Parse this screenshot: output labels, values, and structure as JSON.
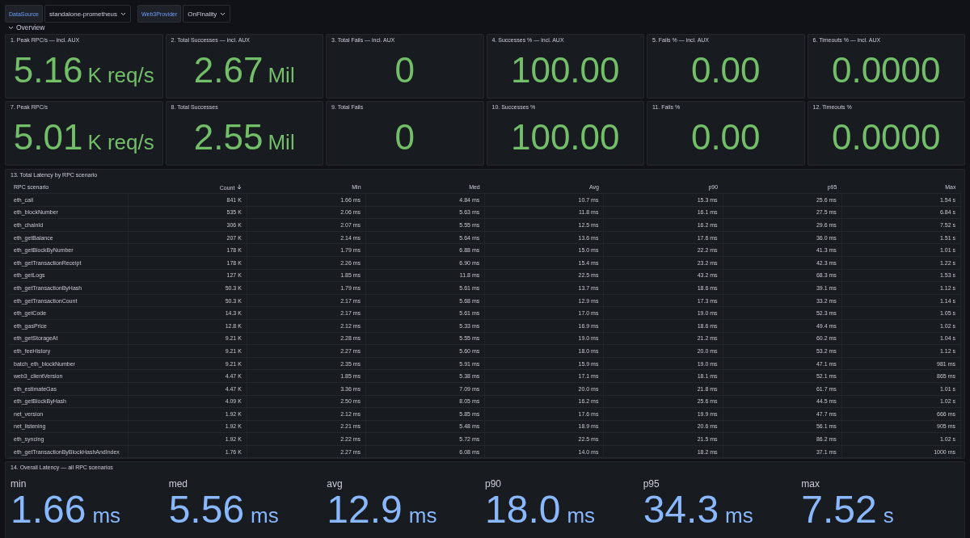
{
  "variables": [
    {
      "label": "DataSource",
      "value": "standalone-prometheus"
    },
    {
      "label": "Web3Provider",
      "value": "OnFinality"
    }
  ],
  "row": {
    "title": "Overview",
    "expanded": true
  },
  "stat_panels": [
    {
      "title": "1. Peak RPC/s — incl. AUX",
      "value": "5.16",
      "unit": "K req/s"
    },
    {
      "title": "2. Total Successes — incl. AUX",
      "value": "2.67",
      "unit": "Mil"
    },
    {
      "title": "3. Total Fails — incl. AUX",
      "value": "0"
    },
    {
      "title": "4. Successes % — incl. AUX",
      "value": "100.00"
    },
    {
      "title": "5. Fails % — incl. AUX",
      "value": "0.00"
    },
    {
      "title": "6. Timeouts % — incl. AUX",
      "value": "0.0000"
    },
    {
      "title": "7. Peak RPC/s",
      "value": "5.01",
      "unit": "K req/s"
    },
    {
      "title": "8. Total Successes",
      "value": "2.55",
      "unit": "Mil"
    },
    {
      "title": "9. Total Fails",
      "value": "0"
    },
    {
      "title": "10. Successes %",
      "value": "100.00"
    },
    {
      "title": "11. Fails %",
      "value": "0.00"
    },
    {
      "title": "12. Timeouts %",
      "value": "0.0000"
    }
  ],
  "table": {
    "title": "13. Total Latency by RPC scenario",
    "columns": [
      {
        "label": "RPC scenario",
        "sorted": false
      },
      {
        "label": "Count",
        "sorted": true
      },
      {
        "label": "Min",
        "sorted": false
      },
      {
        "label": "Med",
        "sorted": false
      },
      {
        "label": "Avg",
        "sorted": false
      },
      {
        "label": "p90",
        "sorted": false
      },
      {
        "label": "p95",
        "sorted": false
      },
      {
        "label": "Max",
        "sorted": false
      }
    ],
    "rows": [
      [
        "eth_call",
        "841 K",
        "1.66 ms",
        "4.84 ms",
        "10.7 ms",
        "15.3 ms",
        "25.6 ms",
        "1.54 s"
      ],
      [
        "eth_blockNumber",
        "535 K",
        "2.06 ms",
        "5.63 ms",
        "11.8 ms",
        "16.1 ms",
        "27.5 ms",
        "6.84 s"
      ],
      [
        "eth_chainId",
        "306 K",
        "2.07 ms",
        "5.55 ms",
        "12.5 ms",
        "16.2 ms",
        "29.6 ms",
        "7.52 s"
      ],
      [
        "eth_getBalance",
        "207 K",
        "2.14 ms",
        "5.64 ms",
        "13.6 ms",
        "17.6 ms",
        "36.0 ms",
        "1.51 s"
      ],
      [
        "eth_getBlockByNumber",
        "178 K",
        "1.79 ms",
        "6.88 ms",
        "15.0 ms",
        "22.2 ms",
        "41.3 ms",
        "1.01 s"
      ],
      [
        "eth_getTransactionReceipt",
        "178 K",
        "2.26 ms",
        "6.90 ms",
        "15.4 ms",
        "23.2 ms",
        "42.3 ms",
        "1.22 s"
      ],
      [
        "eth_getLogs",
        "127 K",
        "1.85 ms",
        "11.8 ms",
        "22.5 ms",
        "43.2 ms",
        "68.3 ms",
        "1.53 s"
      ],
      [
        "eth_getTransactionByHash",
        "50.3 K",
        "1.79 ms",
        "5.61 ms",
        "13.7 ms",
        "18.6 ms",
        "39.1 ms",
        "1.12 s"
      ],
      [
        "eth_getTransactionCount",
        "50.3 K",
        "2.17 ms",
        "5.68 ms",
        "12.9 ms",
        "17.3 ms",
        "33.2 ms",
        "1.14 s"
      ],
      [
        "eth_getCode",
        "14.3 K",
        "2.17 ms",
        "5.61 ms",
        "17.0 ms",
        "19.0 ms",
        "52.3 ms",
        "1.05 s"
      ],
      [
        "eth_gasPrice",
        "12.8 K",
        "2.12 ms",
        "5.33 ms",
        "16.9 ms",
        "18.6 ms",
        "49.4 ms",
        "1.02 s"
      ],
      [
        "eth_getStorageAt",
        "9.21 K",
        "2.28 ms",
        "5.55 ms",
        "19.0 ms",
        "21.2 ms",
        "60.2 ms",
        "1.04 s"
      ],
      [
        "eth_feeHistory",
        "9.21 K",
        "2.27 ms",
        "5.60 ms",
        "18.0 ms",
        "20.0 ms",
        "53.2 ms",
        "1.12 s"
      ],
      [
        "batch_eth_blockNumber",
        "9.21 K",
        "2.35 ms",
        "5.91 ms",
        "15.9 ms",
        "19.0 ms",
        "47.1 ms",
        "981 ms"
      ],
      [
        "web3_clientVersion",
        "4.47 K",
        "1.85 ms",
        "5.38 ms",
        "17.1 ms",
        "18.1 ms",
        "52.1 ms",
        "865 ms"
      ],
      [
        "eth_estimateGas",
        "4.47 K",
        "3.36 ms",
        "7.09 ms",
        "20.0 ms",
        "21.8 ms",
        "61.7 ms",
        "1.01 s"
      ],
      [
        "eth_getBlockByHash",
        "4.09 K",
        "2.50 ms",
        "8.05 ms",
        "16.2 ms",
        "25.6 ms",
        "44.5 ms",
        "1.02 s"
      ],
      [
        "net_version",
        "1.92 K",
        "2.12 ms",
        "5.85 ms",
        "17.6 ms",
        "19.9 ms",
        "47.7 ms",
        "666 ms"
      ],
      [
        "net_listening",
        "1.92 K",
        "2.21 ms",
        "5.48 ms",
        "18.9 ms",
        "20.6 ms",
        "56.1 ms",
        "905 ms"
      ],
      [
        "eth_syncing",
        "1.92 K",
        "2.22 ms",
        "5.72 ms",
        "22.5 ms",
        "21.5 ms",
        "86.2 ms",
        "1.02 s"
      ],
      [
        "eth_getTransactionByBlockHashAndIndex",
        "1.76 K",
        "2.27 ms",
        "6.08 ms",
        "14.0 ms",
        "18.2 ms",
        "37.1 ms",
        "1000 ms"
      ]
    ]
  },
  "latency_panel": {
    "title": "14. Overall Latency — all RPC scenarios",
    "stats": [
      {
        "label": "min",
        "value": "1.66",
        "unit": "ms"
      },
      {
        "label": "med",
        "value": "5.56",
        "unit": "ms"
      },
      {
        "label": "avg",
        "value": "12.9",
        "unit": "ms"
      },
      {
        "label": "p90",
        "value": "18.0",
        "unit": "ms"
      },
      {
        "label": "p95",
        "value": "34.3",
        "unit": "ms"
      },
      {
        "label": "max",
        "value": "7.52",
        "unit": "s"
      }
    ]
  }
}
